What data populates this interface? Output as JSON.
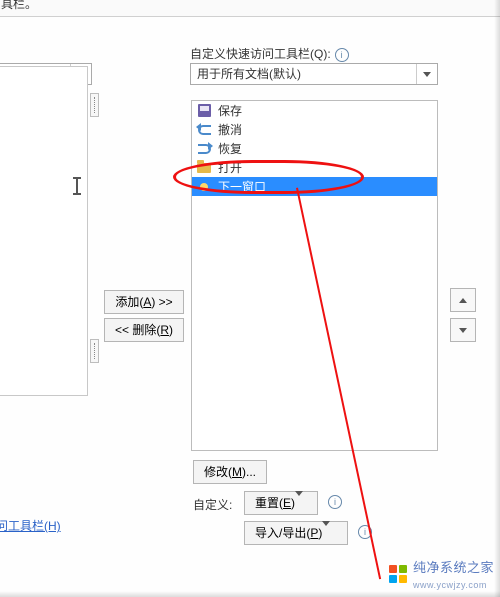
{
  "window": {
    "title_fragment": "具栏。"
  },
  "top_right": {
    "label": "自定义快速访问工具栏(Q):",
    "dropdown_value": "用于所有文档(默认)"
  },
  "left": {
    "qat_link": "问工具栏(H)"
  },
  "buttons": {
    "add": "添加(A) >>",
    "remove": "<< 删除(R)",
    "modify": "修改(M)...",
    "reset": "重置(E)",
    "import_export": "导入/导出(P)"
  },
  "labels": {
    "custom": "自定义:"
  },
  "right_list": {
    "items": [
      {
        "icon": "save-icon",
        "text": "保存"
      },
      {
        "icon": "undo-icon",
        "text": "撤消"
      },
      {
        "icon": "redo-icon",
        "text": "恢复"
      },
      {
        "icon": "open-icon",
        "text": "打开"
      },
      {
        "icon": "dot-icon",
        "text": "下一窗口",
        "selected": true
      }
    ]
  },
  "watermark": {
    "text": "纯净系统之家",
    "url": "www.ycwjzy.com"
  }
}
